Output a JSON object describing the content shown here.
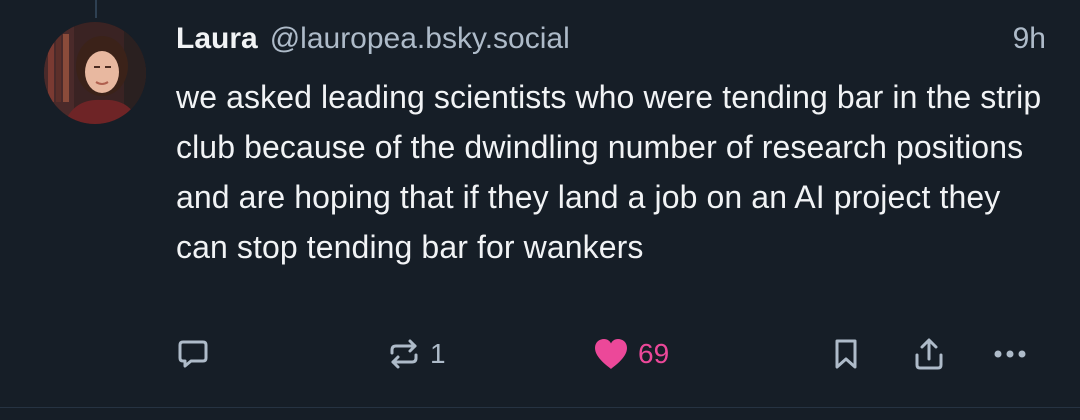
{
  "post": {
    "author": {
      "name": "Laura",
      "handle": "@lauropea.bsky.social"
    },
    "time": "9h",
    "text": "we asked leading scientists who were tending bar in the strip club because of the dwindling number of research positions and are hoping that if they land a job on an AI project they can stop tending bar for wankers",
    "stats": {
      "replies": "",
      "reposts": "1",
      "likes": "69"
    },
    "liked": true
  },
  "icons": {
    "reply": "speech-bubble-icon",
    "repost": "repost-arrows-icon",
    "like": "heart-icon",
    "bookmark": "bookmark-icon",
    "share": "share-icon",
    "more": "ellipsis-icon"
  },
  "colors": {
    "background": "#161e27",
    "text": "#f1f3f5",
    "muted": "#aebbc9",
    "like": "#ec4899"
  }
}
